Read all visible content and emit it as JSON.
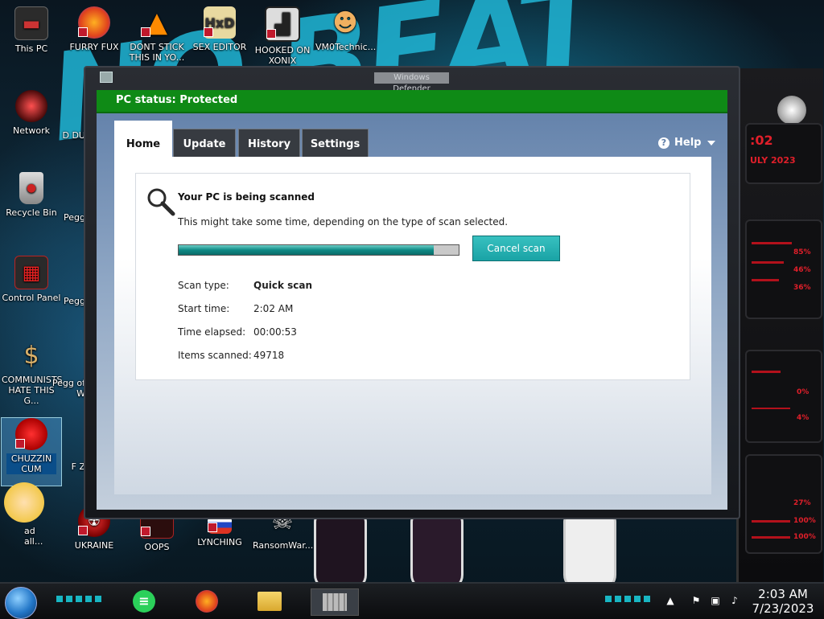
{
  "desktop": {
    "icons": [
      {
        "label": "This PC"
      },
      {
        "label": "FURRY FUX"
      },
      {
        "label": "DONT STICK THIS IN YO..."
      },
      {
        "label": "SEX EDITOR"
      },
      {
        "label": "HOOKED ON XONIX"
      },
      {
        "label": "VM0Technic..."
      },
      {
        "label": "Network"
      },
      {
        "label": "Recycle Bin"
      },
      {
        "label": "Control Panel"
      },
      {
        "label": "COMMUNISTS HATE THIS G..."
      },
      {
        "label": "CHUZZIN CUM"
      },
      {
        "label": "UKRAINE"
      },
      {
        "label": "OOPS"
      },
      {
        "label": "LYNCHING"
      },
      {
        "label": "RansomWar..."
      },
      {
        "label": "Pegg"
      },
      {
        "label": "Pegg"
      },
      {
        "label": "Pegg of W"
      },
      {
        "label": "D DU"
      },
      {
        "label": "F Z"
      },
      {
        "label": "ad all..."
      }
    ]
  },
  "window": {
    "title": "Windows Defender",
    "status": "PC status: Protected",
    "status_color": "#0f8a16",
    "tabs": [
      {
        "label": "Home",
        "active": true
      },
      {
        "label": "Update",
        "active": false
      },
      {
        "label": "History",
        "active": false
      },
      {
        "label": "Settings",
        "active": false
      }
    ],
    "help_label": "Help",
    "scan": {
      "title": "Your PC is being scanned",
      "subtitle": "This might take some time, depending on the type of scan selected.",
      "progress": 0.91,
      "cancel_label": "Cancel scan",
      "rows": [
        {
          "label": "Scan type:",
          "value": "Quick scan",
          "bold": true
        },
        {
          "label": "Start time:",
          "value": "2:02 AM",
          "bold": false
        },
        {
          "label": "Time elapsed:",
          "value": "00:00:53",
          "bold": false
        },
        {
          "label": "Items scanned:",
          "value": "49718",
          "bold": false
        }
      ]
    }
  },
  "widget": {
    "time": ":02",
    "date": "ULY 2023",
    "stats": [
      "85%",
      "46%",
      "36%",
      "0%",
      "4%",
      "27%",
      "100%",
      "100%"
    ]
  },
  "taskbar": {
    "apps": [
      "notes-app",
      "firefox",
      "file-explorer",
      "windows-defender"
    ],
    "clock_time": "2:03 AM",
    "clock_date": "7/23/2023"
  }
}
